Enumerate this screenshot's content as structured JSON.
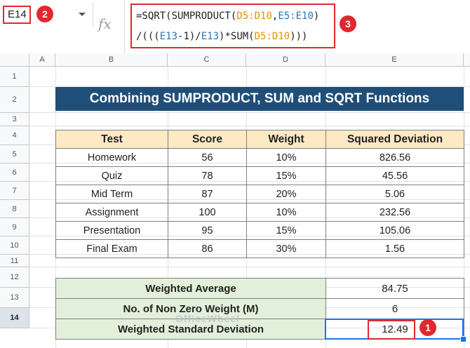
{
  "name_box": "E14",
  "formula": {
    "line1_pre": "=SQRT(SUMPRODUCT(",
    "ref1": "D5:D10",
    "comma": ",",
    "ref2": "E5:E10",
    "line1_post": ")",
    "line2_pre": "/(((",
    "ref3": "E13",
    "mid1": "-1)/",
    "ref4": "E13",
    "mid2": ")*SUM(",
    "ref5": "D5:D10",
    "line2_post": ")))"
  },
  "fx_symbol": "fx",
  "badges": [
    "1",
    "2",
    "3"
  ],
  "columns": [
    "A",
    "B",
    "C",
    "D",
    "E"
  ],
  "rows": [
    "1",
    "2",
    "3",
    "4",
    "5",
    "6",
    "7",
    "8",
    "9",
    "10",
    "11",
    "12",
    "13",
    "14"
  ],
  "title": "Combining SUMPRODUCT, SUM and SQRT Functions",
  "table": {
    "headers": [
      "Test",
      "Score",
      "Weight",
      "Squared Deviation"
    ],
    "rows": [
      [
        "Homework",
        "56",
        "10%",
        "826.56"
      ],
      [
        "Quiz",
        "78",
        "15%",
        "45.56"
      ],
      [
        "Mid Term",
        "87",
        "20%",
        "5.06"
      ],
      [
        "Assignment",
        "100",
        "10%",
        "232.56"
      ],
      [
        "Presentation",
        "95",
        "15%",
        "105.06"
      ],
      [
        "Final Exam",
        "86",
        "30%",
        "1.56"
      ]
    ]
  },
  "summary": [
    {
      "label": "Weighted Average",
      "value": "84.75"
    },
    {
      "label": "No. of Non Zero Weight (M)",
      "value": "6"
    },
    {
      "label": "Weighted Standard Deviation",
      "value": "12.49"
    }
  ],
  "watermark": "OfficeWheel",
  "colors": {
    "accent_red": "#e0282e",
    "title_bg": "#1f4e79",
    "header_bg": "#fde9c4",
    "summary_bg": "#e2efda",
    "selection": "#1a73e8"
  }
}
